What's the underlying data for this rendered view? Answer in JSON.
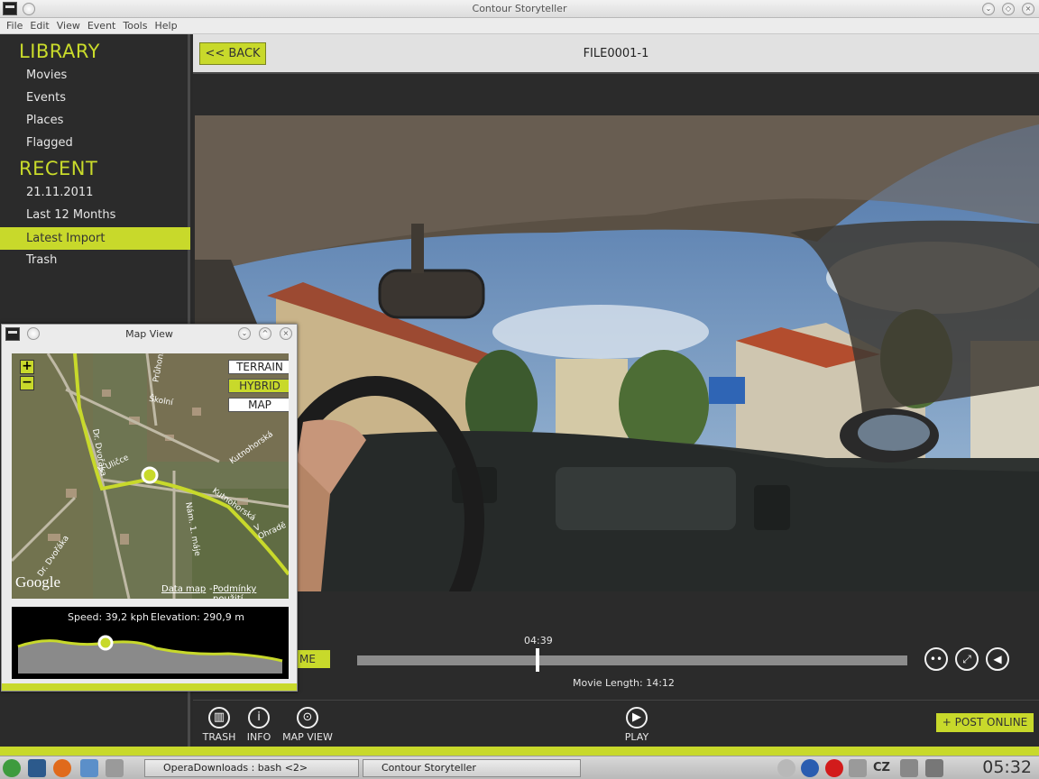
{
  "window": {
    "title": "Contour Storyteller"
  },
  "menu": [
    "File",
    "Edit",
    "View",
    "Event",
    "Tools",
    "Help"
  ],
  "sidebar": {
    "library_heading": "LIBRARY",
    "library_items": [
      "Movies",
      "Events",
      "Places",
      "Flagged"
    ],
    "recent_heading": "RECENT",
    "recent_items": [
      "21.11.2011",
      "Last 12 Months",
      "Latest Import",
      "Trash"
    ],
    "active_item": "Latest Import"
  },
  "header": {
    "back_label": "<< BACK",
    "file_title": "FILE0001-1"
  },
  "player": {
    "current_time": "04:39",
    "movie_length_label": "Movie Length: 14:12",
    "progress": 0.33,
    "home_label": "ME"
  },
  "toolbar": {
    "trash_label": "TRASH",
    "info_label": "INFO",
    "map_view_label": "MAP VIEW",
    "play_label": "PLAY",
    "post_online_label": "+ POST ONLINE"
  },
  "map_window": {
    "title": "Map View",
    "terrain_label": "TERRAIN",
    "hybrid_label": "HYBRID",
    "map_label": "MAP",
    "selected_mode": "HYBRID",
    "zoom_in": "+",
    "zoom_out": "−",
    "google_label": "Google",
    "data_map_label": "Data map",
    "terms_label": "Podmínky použití",
    "street_labels": [
      "Průhonice",
      "Školní",
      "Kutnohorská",
      "V Uličce",
      "Dr. Dvořáka",
      "Nám. 1. máje",
      "V Ohradě",
      "Kutnohorská",
      "Dr. Dvořáka"
    ],
    "speed_label": "Speed: 39,2 kph",
    "elevation_label": "Elevation: 290,9 m"
  },
  "taskbar": {
    "task1": "OperaDownloads : bash <2>",
    "task2": "Contour Storyteller",
    "lang": "CZ",
    "clock": "05:32"
  },
  "colors": {
    "accent": "#c8d92b",
    "panel": "#2b2b2b"
  }
}
